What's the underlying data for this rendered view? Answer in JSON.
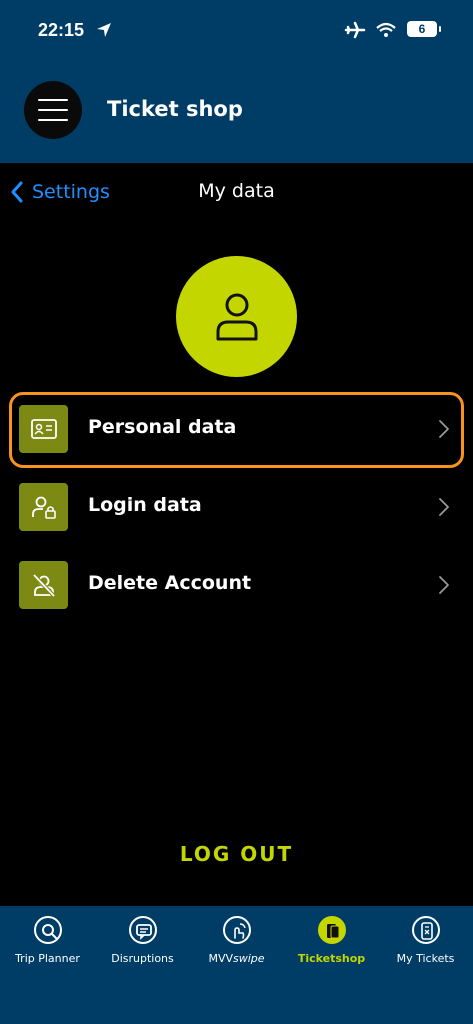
{
  "status_bar": {
    "time": "22:15",
    "battery": "6"
  },
  "header": {
    "title": "Ticket shop"
  },
  "nav": {
    "back_label": "Settings",
    "title": "My data"
  },
  "menu": [
    {
      "label": "Personal data",
      "icon": "id-card-icon",
      "highlighted": true
    },
    {
      "label": "Login data",
      "icon": "user-lock-icon",
      "highlighted": false
    },
    {
      "label": "Delete Account",
      "icon": "user-off-icon",
      "highlighted": false
    }
  ],
  "logout_label": "LOG OUT",
  "tabs": [
    {
      "label": "Trip Planner",
      "icon": "search-icon",
      "active": false
    },
    {
      "label": "Disruptions",
      "icon": "message-icon",
      "active": false
    },
    {
      "label": "MVV",
      "label_suffix": "swipe",
      "icon": "swipe-icon",
      "active": false
    },
    {
      "label": "Ticketshop",
      "icon": "ticketshop-icon",
      "active": true
    },
    {
      "label": "My Tickets",
      "icon": "phone-ticket-icon",
      "active": false
    }
  ],
  "colors": {
    "header_bg": "#003d66",
    "accent": "#c4d600",
    "icon_bg": "#7c8a14",
    "highlight": "#f7931e",
    "link": "#1e90ff"
  }
}
